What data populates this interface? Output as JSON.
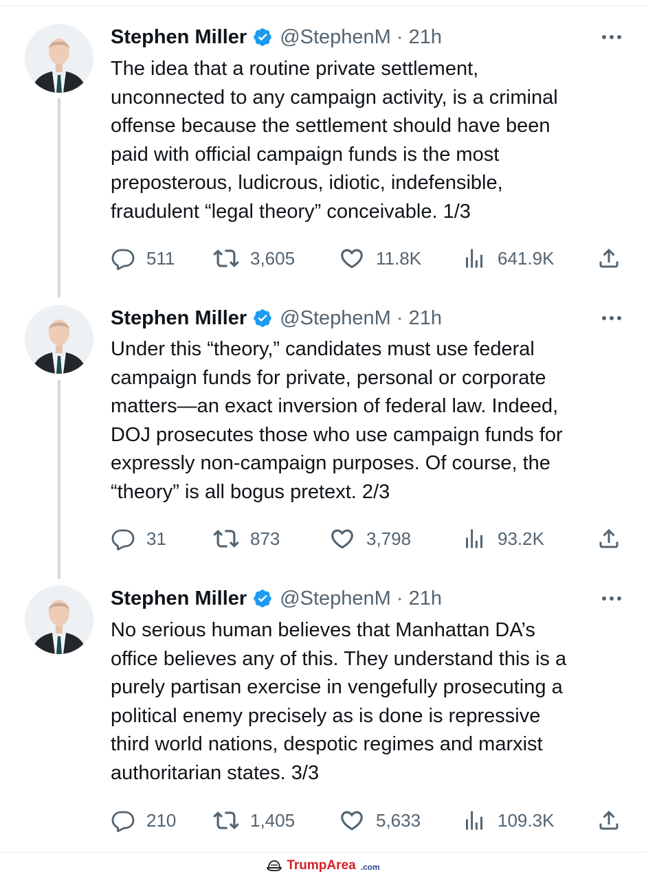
{
  "tweets": [
    {
      "author": "Stephen Miller",
      "handle": "@StephenM · 21h",
      "lines": [
        "The idea that a routine private settlement,",
        "unconnected to any campaign activity, is a criminal",
        "offense because the settlement should have been",
        "paid with official campaign funds is the most",
        "preposterous, ludicrous, idiotic, indefensible,",
        "fraudulent “legal theory” conceivable. 1/3"
      ],
      "replies": "511",
      "retweets": "3,605",
      "likes": "11.8K",
      "views": "641.9K"
    },
    {
      "author": "Stephen Miller",
      "handle": "@StephenM · 21h",
      "lines": [
        "Under this “theory,” candidates must use federal",
        "campaign funds for private, personal or corporate",
        "matters—an exact inversion of federal law. Indeed,",
        "DOJ prosecutes those who use campaign funds for",
        "expressly non-campaign purposes. Of course, the",
        "“theory” is all bogus pretext. 2/3"
      ],
      "replies": "31",
      "retweets": "873",
      "likes": "3,798",
      "views": "93.2K"
    },
    {
      "author": "Stephen Miller",
      "handle": "@StephenM · 21h",
      "lines": [
        "No serious human believes that Manhattan DA’s",
        "office believes any of this. They understand this is a",
        "purely partisan exercise in vengefully prosecuting a",
        "political enemy precisely as is done is repressive",
        "third world nations, despotic regimes and marxist",
        "authoritarian states. 3/3"
      ],
      "replies": "210",
      "retweets": "1,405",
      "likes": "5,633",
      "views": "109.3K"
    }
  ],
  "watermark": {
    "name": "TrumpArea",
    "tld": ".com"
  },
  "colors": {
    "text": "#0f1419",
    "secondary": "#536471",
    "verified": "#1d9bf0",
    "thread_line": "#cfd9de",
    "watermark_red": "#d62027",
    "watermark_blue": "#2a4b8d"
  },
  "icons": [
    "verified-badge-icon",
    "more-icon",
    "reply-icon",
    "retweet-icon",
    "like-icon",
    "views-icon",
    "share-icon",
    "cap-icon"
  ]
}
